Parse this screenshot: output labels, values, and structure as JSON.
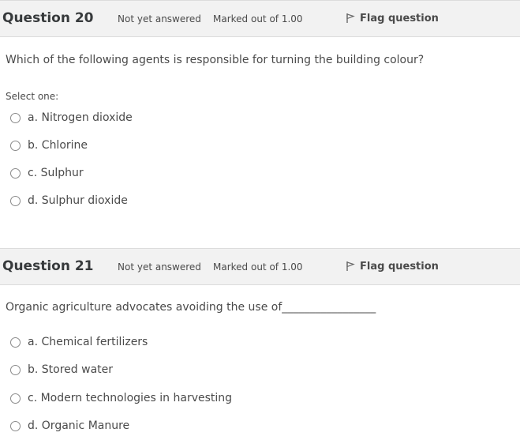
{
  "questions": [
    {
      "title": "Question 20",
      "status": "Not yet answered",
      "marks": "Marked out of 1.00",
      "flag_label": "Flag question",
      "text": "Which of the following agents is responsible for turning the building colour?",
      "prompt": "Select one:",
      "options": [
        "a. Nitrogen dioxide",
        "b. Chlorine",
        "c. Sulphur",
        "d. Sulphur dioxide"
      ]
    },
    {
      "title": "Question 21",
      "status": "Not yet answered",
      "marks": "Marked out of 1.00",
      "flag_label": "Flag question",
      "text": "Organic agriculture advocates avoiding the use of_________________",
      "options": [
        "a. Chemical fertilizers",
        "b. Stored water",
        "c. Modern technologies in harvesting",
        "d. Organic Manure"
      ]
    }
  ]
}
